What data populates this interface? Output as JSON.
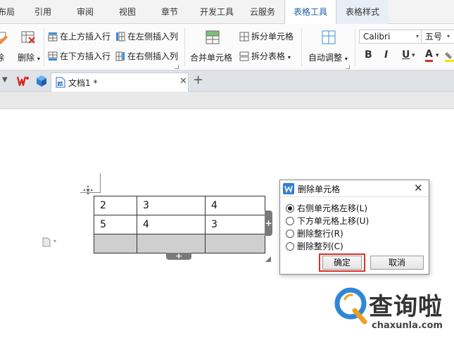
{
  "tabs": [
    {
      "label": "布局"
    },
    {
      "label": "引用"
    },
    {
      "label": "审阅"
    },
    {
      "label": "视图"
    },
    {
      "label": "章节"
    },
    {
      "label": "开发工具"
    },
    {
      "label": "云服务"
    },
    {
      "label": "表格工具"
    },
    {
      "label": "表格样式"
    }
  ],
  "ribbon": {
    "delete_label": "删除",
    "insert_above": "在上方插入行",
    "insert_below": "在下方插入行",
    "insert_left": "在左侧插入列",
    "insert_right": "在右侧插入列",
    "merge_cells": "合并单元格",
    "split_cells": "拆分单元格",
    "split_table": "拆分表格",
    "auto_fit": "自动调整",
    "font_name": "Calibri",
    "font_size": "五号",
    "bold": "B",
    "italic": "I",
    "underline": "U",
    "font_color": "A"
  },
  "doc_tab": {
    "title": "文档1 *"
  },
  "table": {
    "rows": [
      [
        "2",
        "3",
        "4"
      ],
      [
        "5",
        "4",
        "3"
      ],
      [
        "",
        "",
        ""
      ]
    ]
  },
  "dialog": {
    "title": "删除单元格",
    "options": [
      {
        "label": "右侧单元格左移(L)",
        "checked": true
      },
      {
        "label": "下方单元格上移(U)",
        "checked": false
      },
      {
        "label": "删除整行(R)",
        "checked": false
      },
      {
        "label": "删除整列(C)",
        "checked": false
      }
    ],
    "ok_label": "确定",
    "cancel_label": "取消"
  },
  "watermark": {
    "brand": "查询啦",
    "domain": "chaxunla.com"
  },
  "colors": {
    "accent": "#1e5fa8",
    "highlight_box": "#d9302a",
    "wps_red": "#d8251d"
  }
}
